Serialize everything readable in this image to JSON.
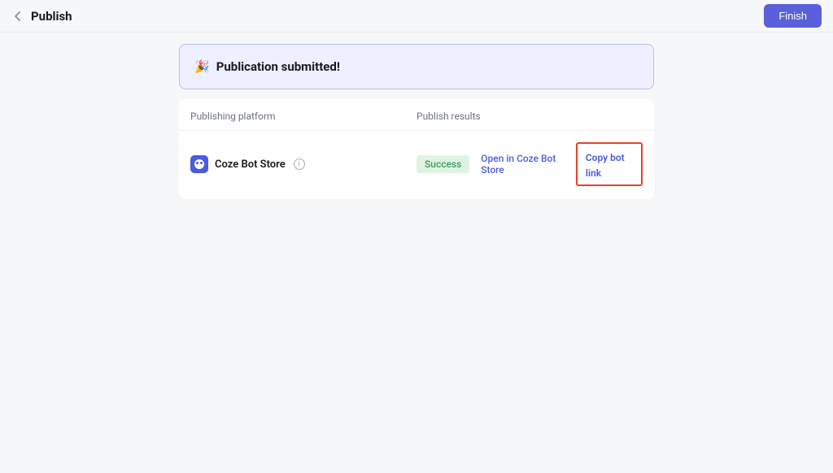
{
  "header": {
    "title": "Publish",
    "finish_label": "Finish"
  },
  "banner": {
    "emoji": "🎉",
    "text": "Publication submitted!"
  },
  "table": {
    "headers": {
      "platform": "Publishing platform",
      "results": "Publish results"
    },
    "row": {
      "platform_name": "Coze Bot Store",
      "status": "Success",
      "open_link_label": "Open in Coze Bot Store",
      "copy_link_label": "Copy bot link"
    }
  }
}
